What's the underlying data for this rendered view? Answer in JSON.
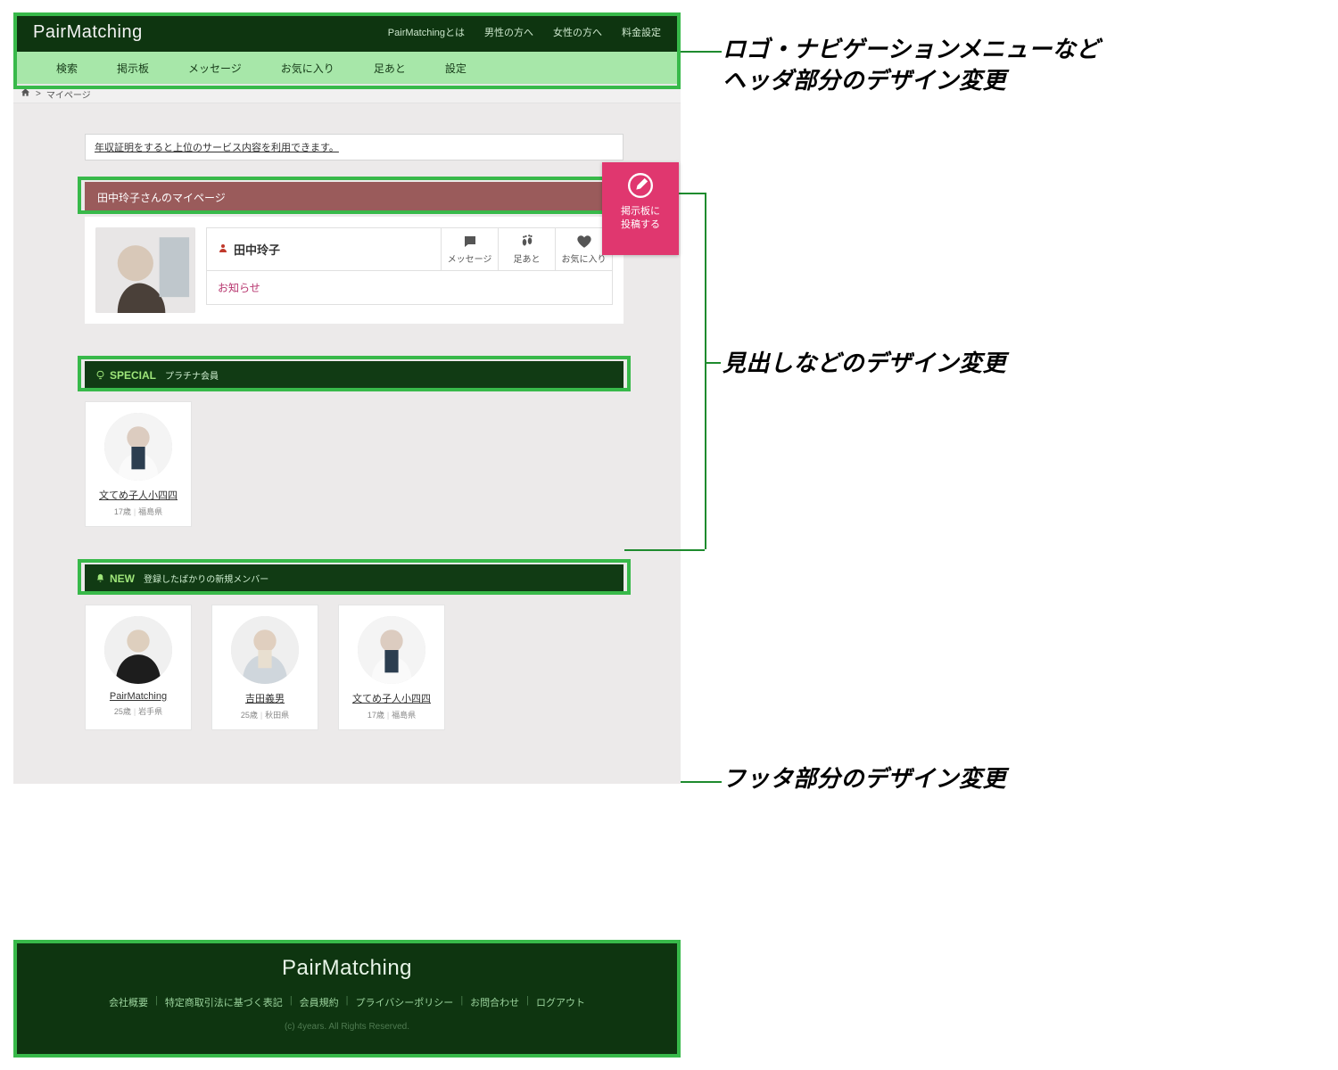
{
  "logo": "PairMatching",
  "topnav": [
    "PairMatchingとは",
    "男性の方へ",
    "女性の方へ",
    "料金設定"
  ],
  "subnav": [
    "検索",
    "掲示板",
    "メッセージ",
    "お気に入り",
    "足あと",
    "設定"
  ],
  "breadcrumb": {
    "sep": ">",
    "current": "マイページ"
  },
  "notice_link": "年収証明をすると上位のサービス内容を利用できます。",
  "post_badge": {
    "line1": "掲示板に",
    "line2": "投稿する"
  },
  "mypage_title": "田中玲子さんのマイページ",
  "profile": {
    "name": "田中玲子",
    "actions": [
      "メッセージ",
      "足あと",
      "お気に入り"
    ],
    "notice_label": "お知らせ"
  },
  "sections": {
    "special": {
      "badge": "SPECIAL",
      "sub": "プラチナ会員"
    },
    "new": {
      "badge": "NEW",
      "sub": "登録したばかりの新規メンバー"
    }
  },
  "special_members": [
    {
      "name": "文てめ子人小四四",
      "age": "17歳",
      "pref": "福島県"
    }
  ],
  "new_members": [
    {
      "name": "PairMatching",
      "age": "25歳",
      "pref": "岩手県"
    },
    {
      "name": "吉田義男",
      "age": "25歳",
      "pref": "秋田県"
    },
    {
      "name": "文てめ子人小四四",
      "age": "17歳",
      "pref": "福島県"
    }
  ],
  "footer": {
    "logo": "PairMatching",
    "links": [
      "会社概要",
      "特定商取引法に基づく表記",
      "会員規約",
      "プライバシーポリシー",
      "お問合わせ",
      "ログアウト"
    ],
    "copyright": "(c) 4years. All Rights Reserved."
  },
  "annotations": {
    "header": "ロゴ・ナビゲーションメニューなど\nヘッダ部分のデザイン変更",
    "heading": "見出しなどのデザイン変更",
    "footer": "フッタ部分のデザイン変更"
  }
}
